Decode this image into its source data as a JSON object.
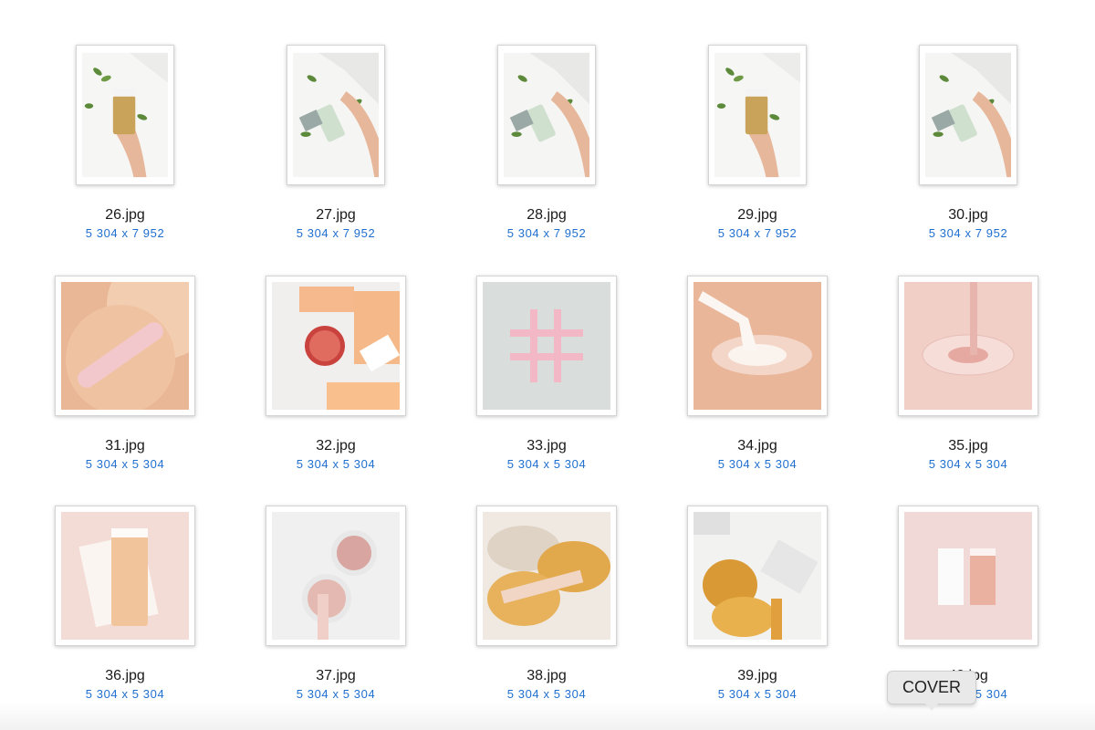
{
  "files": [
    {
      "name": "26.jpg",
      "dims": "5 304 x 7 952",
      "icon": "waxing-hand-leaves-photo",
      "accent": "#c9a35a"
    },
    {
      "name": "27.jpg",
      "dims": "5 304 x 7 952",
      "icon": "waxing-hand-green-cartridge-photo",
      "accent": "#cfe0cf"
    },
    {
      "name": "28.jpg",
      "dims": "5 304 x 7 952",
      "icon": "waxing-hand-green-cartridge-photo",
      "accent": "#cfe0cf"
    },
    {
      "name": "29.jpg",
      "dims": "5 304 x 7 952",
      "icon": "waxing-hand-leaves-photo",
      "accent": "#c9a35a"
    },
    {
      "name": "30.jpg",
      "dims": "5 304 x 7 952",
      "icon": "waxing-hand-green-cartridge-photo",
      "accent": "#cfe0cf"
    },
    {
      "name": "31.jpg",
      "dims": "5 304 x 5 304",
      "icon": "sugar-paste-spatula-photo",
      "accent": "#e9b796"
    },
    {
      "name": "32.jpg",
      "dims": "5 304 x 5 304",
      "icon": "wax-bars-grapefruit-photo",
      "accent": "#f6b98d"
    },
    {
      "name": "33.jpg",
      "dims": "5 304 x 5 304",
      "icon": "pink-razors-hashtag-photo",
      "accent": "#f2b8c6"
    },
    {
      "name": "34.jpg",
      "dims": "5 304 x 5 304",
      "icon": "white-paste-dish-photo",
      "accent": "#e9b69a"
    },
    {
      "name": "35.jpg",
      "dims": "5 304 x 5 304",
      "icon": "pink-gel-petri-dish-photo",
      "accent": "#f1cfc6"
    },
    {
      "name": "36.jpg",
      "dims": "5 304 x 5 304",
      "icon": "wax-cartridge-strips-photo",
      "accent": "#f2c49c"
    },
    {
      "name": "37.jpg",
      "dims": "5 304 x 5 304",
      "icon": "rose-wax-glitter-bowls-photo",
      "accent": "#d9a5a0"
    },
    {
      "name": "38.jpg",
      "dims": "5 304 x 5 304",
      "icon": "honey-wax-bowls-photo",
      "accent": "#e2a84c"
    },
    {
      "name": "39.jpg",
      "dims": "5 304 x 5 304",
      "icon": "honey-jars-strips-photo",
      "accent": "#d99a35"
    },
    {
      "name": "40.jpg",
      "dims": "5 304 x 5 304",
      "icon": "pink-cartridges-cover-photo",
      "accent": "#eab1a1"
    }
  ],
  "tooltip": {
    "label": "COVER"
  }
}
